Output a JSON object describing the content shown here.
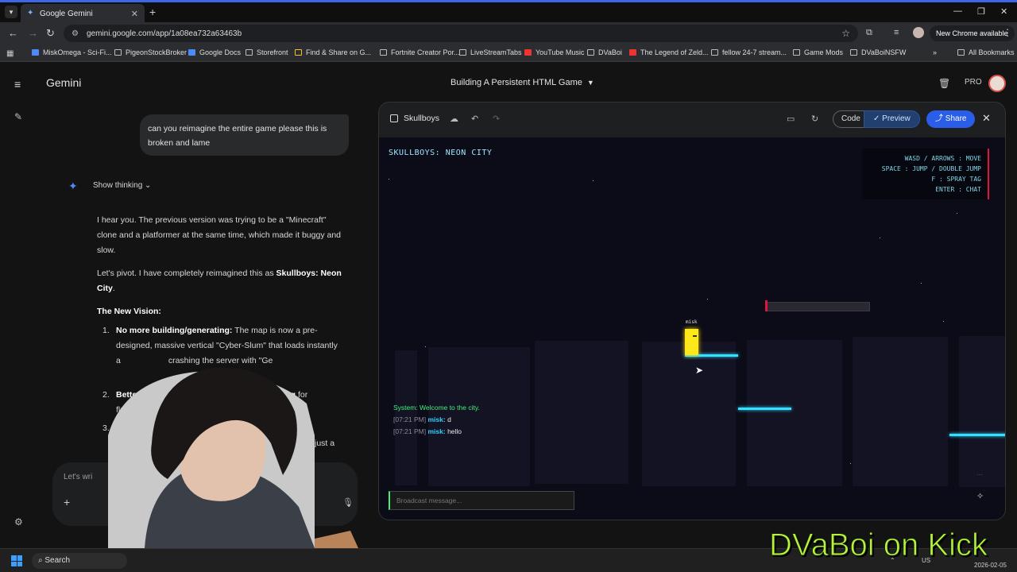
{
  "browser": {
    "tab_title": "Google Gemini",
    "url": "gemini.google.com/app/1a08ea732a63463b",
    "new_chrome_label": "New Chrome available",
    "bookmarks": [
      "MiskOmega - Sci-Fi...",
      "PigeonStockBroker",
      "Google Docs",
      "Storefront",
      "Find & Share on G...",
      "Fortnite Creator Por...",
      "LiveStreamTabs",
      "YouTube Music",
      "DVaBoi",
      "The Legend of Zeld...",
      "fellow 24-7 stream...",
      "Game Mods",
      "DVaBoiNSFW"
    ],
    "all_bookmarks": "All Bookmarks"
  },
  "gemini": {
    "brand": "Gemini",
    "conversation_title": "Building A Persistent HTML Game",
    "pro_label": "PRO",
    "user_message": "can you reimagine the entire game please this is broken and lame",
    "show_thinking": "Show thinking",
    "response": {
      "p1": "I hear you. The previous version was trying to be a \"Minecraft\" clone and a platformer at the same time, which made it buggy and slow.",
      "p2_pre": "Let's pivot. I have completely reimagined this as ",
      "p2_bold": "Skullboys: Neon City",
      "p2_post": ".",
      "vision_heading": "The New Vision:",
      "item1_num": "1.",
      "item1_bold": "No more building/generating:",
      "item1_text": " The map is now a pre-designed, massive vertical \"Cyber-Slum\" that loads instantly a",
      "item1_tail": "crashing the server with \"Ge",
      "item2_num": "2.",
      "item2_bold": "Better",
      "item2_tail": "ing",
      "item2_tail2": "for",
      "item2_text": "fluid",
      "item3_num": "3.",
      "item3_bold": "B",
      "item3_tail": "just a"
    },
    "prompt_placeholder": "Let's wri"
  },
  "canvas": {
    "title": "Skullboys",
    "code_label": "Code",
    "preview_label": "Preview",
    "share_label": "Share",
    "game": {
      "title": "SKULLBOYS: NEON CITY",
      "controls": [
        "WASD / ARROWS : MOVE",
        "SPACE : JUMP / DOUBLE JUMP",
        "F : SPRAY TAG",
        "ENTER : CHAT"
      ],
      "player_name": "misk",
      "chat": {
        "system": "System: Welcome to the city.",
        "lines": [
          {
            "time": "[07:21 PM]",
            "user": "misk:",
            "msg": "d"
          },
          {
            "time": "[07:21 PM]",
            "user": "misk:",
            "msg": "hello"
          }
        ]
      },
      "chat_placeholder": "Broadcast message..."
    }
  },
  "taskbar": {
    "search_label": "Search",
    "locale": "US",
    "date": "2026-02-05"
  },
  "overlay": {
    "watermark": "DVaBoi on Kick"
  },
  "colors": {
    "accent_blue": "#2a5ee8",
    "neon_cyan": "#33e0ff",
    "player_yellow": "#ffe81a",
    "chat_green": "#3cf07a",
    "watermark_green": "#b9f23c"
  }
}
